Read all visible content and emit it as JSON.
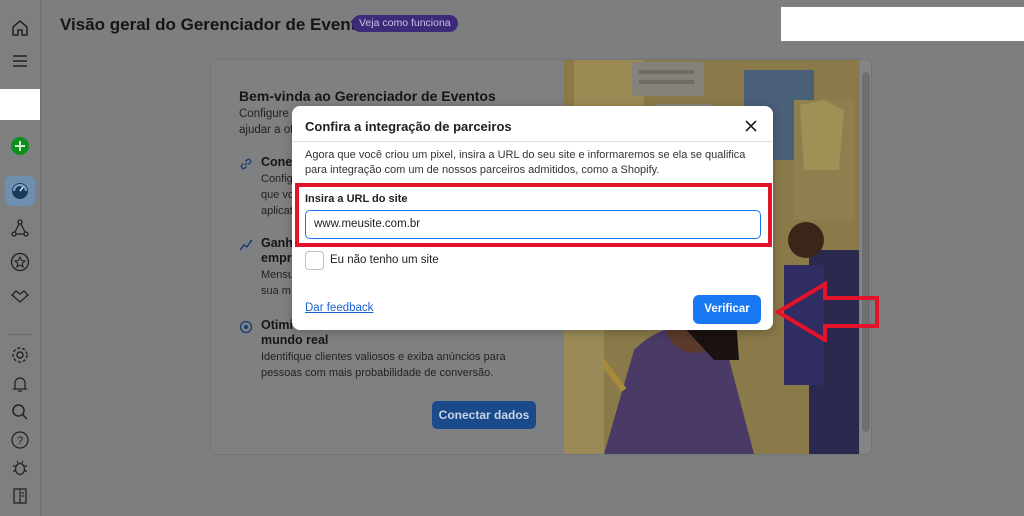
{
  "header": {
    "title": "Visão geral do Gerenciador de Eventos",
    "badge": "Veja como funciona"
  },
  "rail": {
    "icons": [
      "home-icon",
      "menu-icon",
      "add-icon",
      "overview-icon",
      "graph-icon",
      "star-icon",
      "handshake-icon",
      "settings-icon",
      "bell-icon",
      "search-icon",
      "help-icon",
      "bug-icon",
      "report-icon"
    ],
    "add_color": "#0e8f1b"
  },
  "welcome_card": {
    "heading": "Bem-vinda ao Gerenciador de Eventos",
    "intro_line1": "Configure c",
    "intro_line2": "ajudar a ot",
    "features": [
      {
        "icon": "link-icon",
        "title": "Conec",
        "desc_lines": [
          "Config",
          "que vo",
          "aplicat"
        ]
      },
      {
        "icon": "sparkle-chart-icon",
        "title_lines": [
          "Ganhe",
          "empre"
        ],
        "desc_lines": [
          "Mensu",
          "sua m"
        ]
      },
      {
        "icon": "target-icon",
        "title_lines": [
          "Otimi",
          "mundo real"
        ],
        "desc_lines": [
          "Identifique clientes valiosos e exiba anúncios para",
          "pessoas com mais probabilidade de conversão."
        ]
      }
    ],
    "cta_label": "Conectar dados"
  },
  "modal": {
    "title": "Confira a integração de parceiros",
    "description": "Agora que você criou um pixel, insira a URL do seu site e informaremos se ela se qualifica para integração com um de nossos parceiros admitidos, como a Shopify.",
    "url_label": "Insira a URL do site",
    "url_value": "www.meusite.com.br",
    "no_site_label": "Eu não tenho um site",
    "no_site_checked": false,
    "feedback_label": "Dar feedback",
    "verify_label": "Verificar"
  },
  "colors": {
    "highlight": "#e3132a",
    "primary": "#1877f2",
    "badge_bg": "#3d2a78"
  }
}
